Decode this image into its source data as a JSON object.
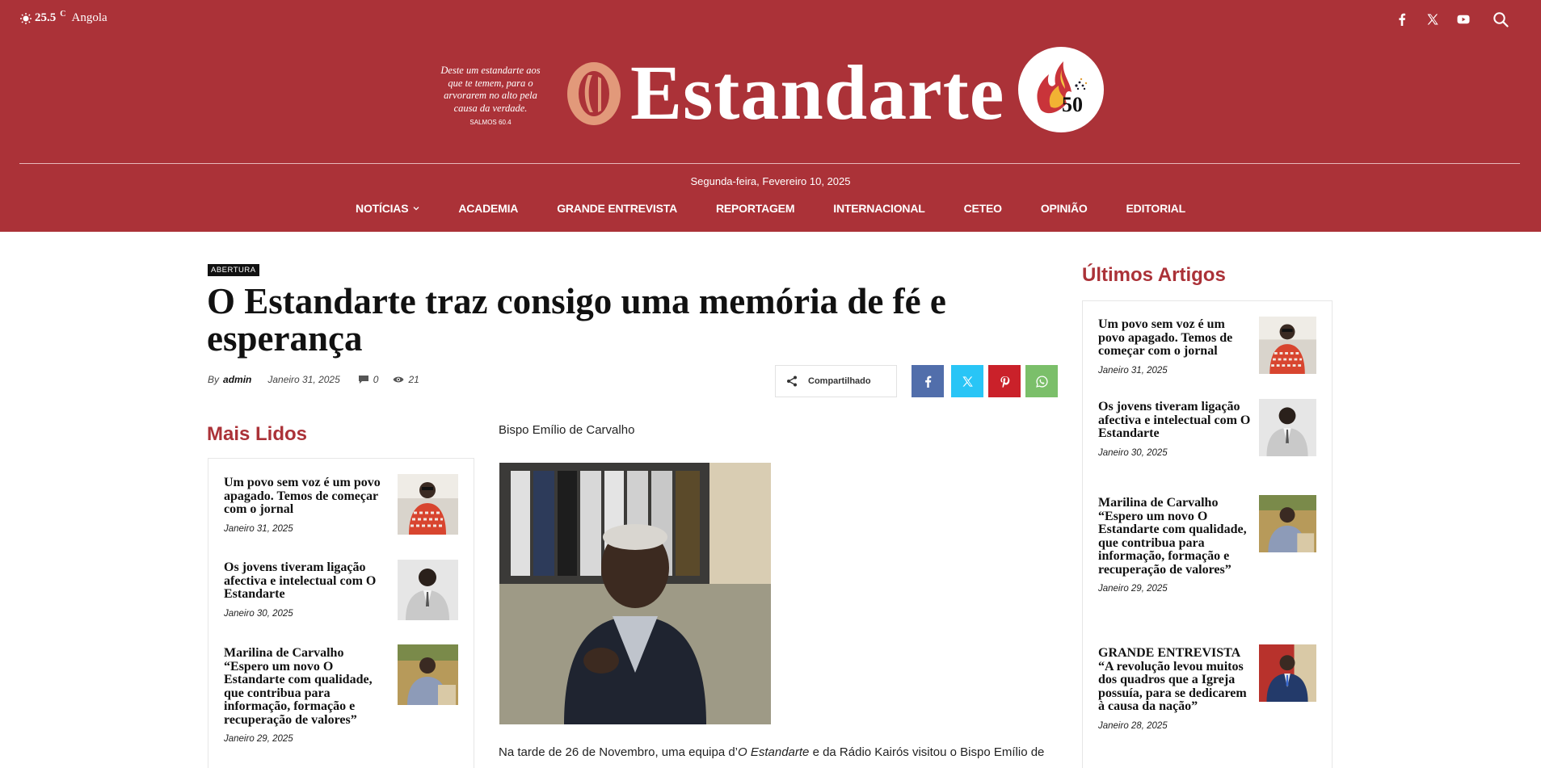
{
  "header": {
    "weather": {
      "temp": "25.5",
      "unit": "C",
      "location": "Angola",
      "icon": "weather-sun-icon"
    },
    "socials": [
      {
        "name": "facebook-icon"
      },
      {
        "name": "x-icon"
      },
      {
        "name": "youtube-icon"
      },
      {
        "name": "search-icon"
      }
    ],
    "motto": "Deste um estandarte aos que te temem, para o arvorarem no alto pela causa da verdade.",
    "motto_ref": "SALMOS 60.4",
    "logo_text": "Estandarte",
    "badge_number": "50",
    "date": "Segunda-feira, Fevereiro 10, 2025",
    "nav": [
      "NOTÍCIAS",
      "ACADEMIA",
      "GRANDE ENTREVISTA",
      "REPORTAGEM",
      "INTERNACIONAL",
      "CETEO",
      "OPINIÃO",
      "EDITORIAL"
    ],
    "brand_color": "#ab3238"
  },
  "article": {
    "category": "ABERTURA",
    "title": "O Estandarte traz consigo uma memória de fé e esperança",
    "by": "By",
    "author": "admin",
    "date": "Janeiro 31, 2025",
    "comments": "0",
    "views": "21",
    "share_label": "Compartilhado",
    "share_colors": {
      "facebook": "#516eab",
      "twitter": "#29c5f6",
      "pinterest": "#ca212a",
      "whatsapp": "#7bbf6a"
    },
    "caption": "Bispo Emílio de Carvalho",
    "body_start": "Na tarde de 26 de Novembro, uma equipa d’",
    "body_em": "O Estandarte",
    "body_end": " e da Rádio Kairós visitou o Bispo Emílio de"
  },
  "mais_lidos": {
    "title": "Mais Lidos",
    "items": [
      {
        "title": "Um povo sem voz é um povo apagado. Temos de começar com o jornal",
        "date": "Janeiro 31, 2025"
      },
      {
        "title": "Os jovens tiveram ligação afectiva e intelectual com O Estandarte",
        "date": "Janeiro 30, 2025"
      },
      {
        "title": "Marilina de Carvalho “Espero um novo O Estandarte com qualidade, que contribua para informação, formação e recuperação de valores”",
        "date": "Janeiro 29, 2025"
      }
    ]
  },
  "ultimos": {
    "title": "Últimos Artigos",
    "items": [
      {
        "title": "Um povo sem voz é um povo apagado. Temos de começar com o jornal",
        "date": "Janeiro 31, 2025"
      },
      {
        "title": "Os jovens tiveram ligação afectiva e intelectual com O Estandarte",
        "date": "Janeiro 30, 2025"
      },
      {
        "title": "Marilina de Carvalho “Espero um novo O Estandarte com qualidade, que contribua para informação, formação e recuperação de valores”",
        "date": "Janeiro 29, 2025"
      },
      {
        "title": "GRANDE ENTREVISTA “A revolução levou muitos dos quadros que a Igreja possuía, para se dedicarem à causa da nação”",
        "date": "Janeiro 28, 2025"
      }
    ]
  }
}
